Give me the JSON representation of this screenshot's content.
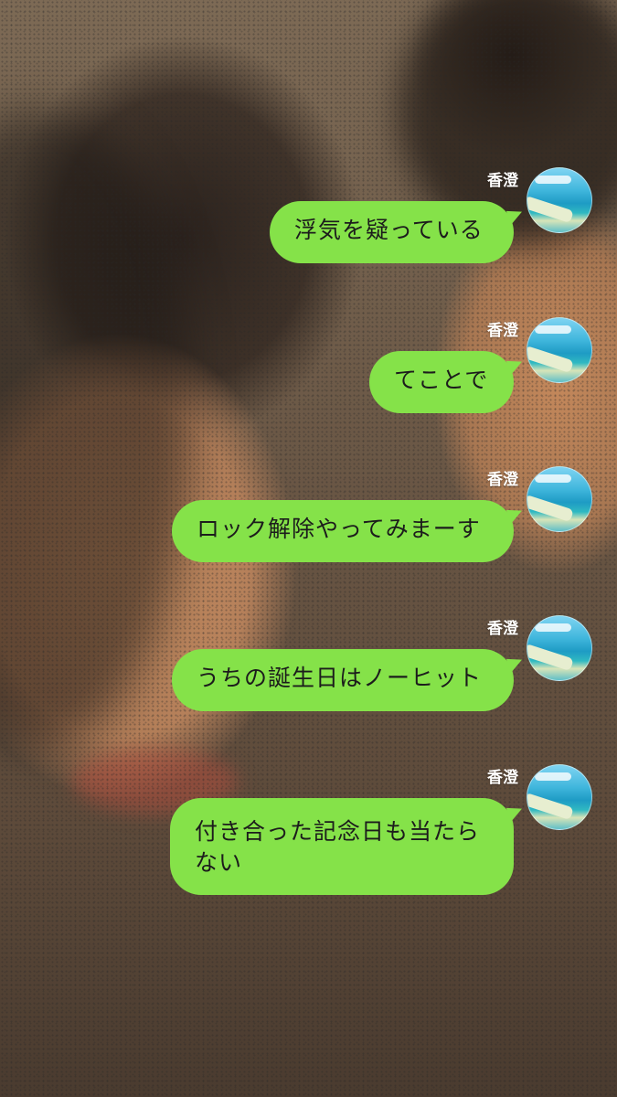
{
  "sender_name": "香澄",
  "messages": [
    {
      "text": "浮気を疑っている"
    },
    {
      "text": "てことで"
    },
    {
      "text": "ロック解除やってみまーす"
    },
    {
      "text": "うちの誕生日はノーヒット"
    },
    {
      "text": "付き合った記念日も当たらない"
    }
  ],
  "colors": {
    "bubble": "#85e249",
    "text": "#1c1c1c",
    "sender": "#ffffff"
  },
  "icons": {
    "avatar": "beach-avatar-icon"
  }
}
